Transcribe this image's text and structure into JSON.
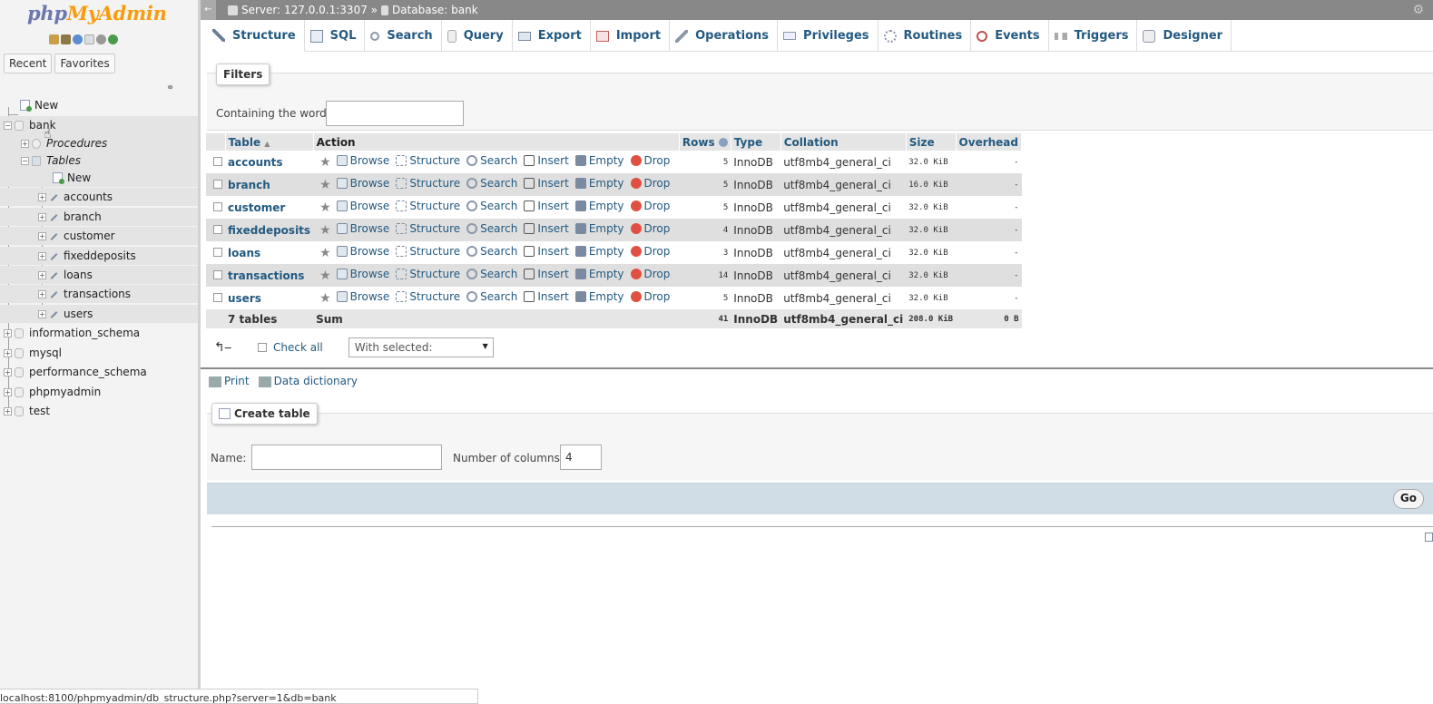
{
  "nav": {
    "logo_a": "php",
    "logo_b": "MyAdmin",
    "tabs": [
      "Recent",
      "Favorites"
    ],
    "new_label": "New",
    "bank": "bank",
    "procedures": "Procedures",
    "tables": "Tables",
    "tables_new": "New",
    "tables_list": [
      "accounts",
      "branch",
      "customer",
      "fixeddeposits",
      "loans",
      "transactions",
      "users"
    ],
    "databases": [
      "information_schema",
      "mysql",
      "performance_schema",
      "phpmyadmin",
      "test"
    ]
  },
  "topbar": {
    "server": "Server: 127.0.0.1:3307 »",
    "database": "Database: bank"
  },
  "menu": [
    {
      "label": "Structure",
      "icon": "structure-icon"
    },
    {
      "label": "SQL",
      "icon": "sql-icon"
    },
    {
      "label": "Search",
      "icon": "search-icon"
    },
    {
      "label": "Query",
      "icon": "query-icon"
    },
    {
      "label": "Export",
      "icon": "export-icon"
    },
    {
      "label": "Import",
      "icon": "import-icon"
    },
    {
      "label": "Operations",
      "icon": "wrench-icon"
    },
    {
      "label": "Privileges",
      "icon": "privileges-icon"
    },
    {
      "label": "Routines",
      "icon": "routines-icon"
    },
    {
      "label": "Events",
      "icon": "clock-icon"
    },
    {
      "label": "Triggers",
      "icon": "triggers-icon"
    },
    {
      "label": "Designer",
      "icon": "designer-icon"
    }
  ],
  "filters": {
    "legend": "Filters",
    "label": "Containing the word:",
    "value": ""
  },
  "table": {
    "headers": {
      "table": "Table",
      "action": "Action",
      "rows": "Rows",
      "type": "Type",
      "collation": "Collation",
      "size": "Size",
      "overhead": "Overhead"
    },
    "actions": {
      "browse": "Browse",
      "structure": "Structure",
      "search": "Search",
      "insert": "Insert",
      "empty": "Empty",
      "drop": "Drop"
    },
    "rows": [
      {
        "name": "accounts",
        "rows": "5",
        "type": "InnoDB",
        "collation": "utf8mb4_general_ci",
        "size": "32.0 KiB",
        "overhead": "-"
      },
      {
        "name": "branch",
        "rows": "5",
        "type": "InnoDB",
        "collation": "utf8mb4_general_ci",
        "size": "16.0 KiB",
        "overhead": "-"
      },
      {
        "name": "customer",
        "rows": "5",
        "type": "InnoDB",
        "collation": "utf8mb4_general_ci",
        "size": "32.0 KiB",
        "overhead": "-"
      },
      {
        "name": "fixeddeposits",
        "rows": "4",
        "type": "InnoDB",
        "collation": "utf8mb4_general_ci",
        "size": "32.0 KiB",
        "overhead": "-"
      },
      {
        "name": "loans",
        "rows": "3",
        "type": "InnoDB",
        "collation": "utf8mb4_general_ci",
        "size": "32.0 KiB",
        "overhead": "-"
      },
      {
        "name": "transactions",
        "rows": "14",
        "type": "InnoDB",
        "collation": "utf8mb4_general_ci",
        "size": "32.0 KiB",
        "overhead": "-"
      },
      {
        "name": "users",
        "rows": "5",
        "type": "InnoDB",
        "collation": "utf8mb4_general_ci",
        "size": "32.0 KiB",
        "overhead": "-"
      }
    ],
    "footer": {
      "count": "7 tables",
      "sum": "Sum",
      "rows": "41",
      "type": "InnoDB",
      "collation": "utf8mb4_general_ci",
      "size": "208.0 KiB",
      "overhead": "0 B"
    }
  },
  "bulk": {
    "check_all": "Check all",
    "with_selected": "With selected:"
  },
  "links": {
    "print": "Print",
    "data_dictionary": "Data dictionary"
  },
  "create": {
    "legend": "Create table",
    "name_label": "Name:",
    "name_value": "",
    "cols_label": "Number of columns:",
    "cols_value": "4",
    "go": "Go"
  },
  "status_url": "localhost:8100/phpmyadmin/db_structure.php?server=1&db=bank"
}
